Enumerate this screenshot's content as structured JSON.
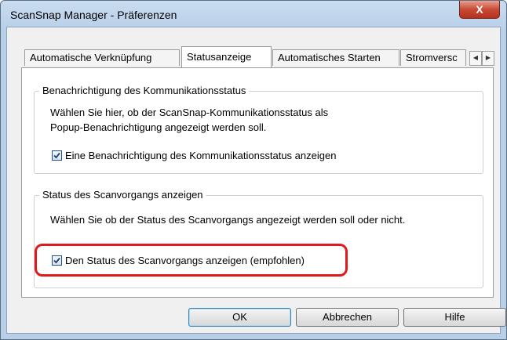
{
  "window": {
    "title": "ScanSnap Manager - Präferenzen",
    "close_glyph": "X"
  },
  "tabs": [
    {
      "label": "Automatische Verknüpfung",
      "active": false
    },
    {
      "label": "Statusanzeige",
      "active": true
    },
    {
      "label": "Automatisches Starten",
      "active": false
    },
    {
      "label": "Stromversc",
      "active": false
    }
  ],
  "tab_scroll": {
    "left": "◀",
    "right": "▶"
  },
  "groups": {
    "communication": {
      "legend": "Benachrichtigung des Kommunikationsstatus",
      "description_lines": [
        "Wählen Sie hier, ob der ScanSnap-Kommunikationsstatus als",
        "Popup-Benachrichtigung angezeigt werden soll."
      ],
      "checkbox_label": "Eine Benachrichtigung des Kommunikationsstatus anzeigen",
      "checked": true
    },
    "scan_status": {
      "legend": "Status des Scanvorgangs anzeigen",
      "description": "Wählen Sie ob der Status des Scanvorgangs angezeigt werden soll oder nicht.",
      "checkbox_label": "Den Status des Scanvorgangs anzeigen (empfohlen)",
      "checked": true
    }
  },
  "buttons": {
    "ok": "OK",
    "cancel": "Abbrechen",
    "help": "Hilfe"
  },
  "colors": {
    "highlight": "#e0191b",
    "close_button": "#c74a36"
  }
}
